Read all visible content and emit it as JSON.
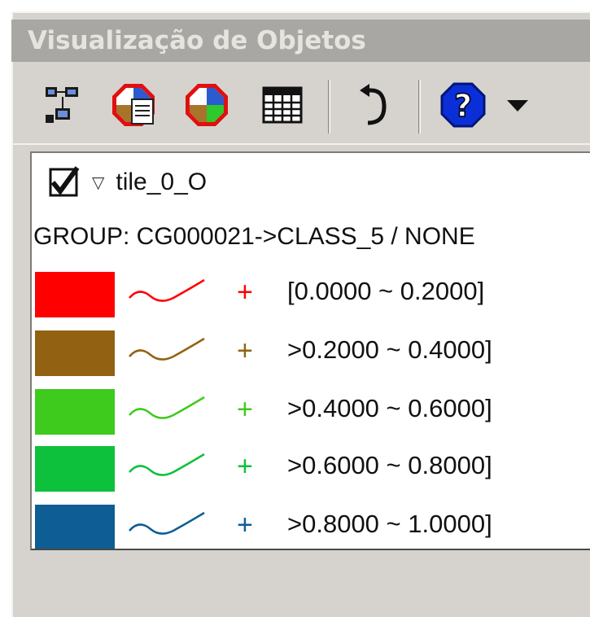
{
  "window": {
    "title": "Visualização de Objetos"
  },
  "toolbar": {
    "buttons": [
      {
        "name": "tree-layout-icon"
      },
      {
        "name": "layer-properties-icon"
      },
      {
        "name": "layer-style-icon"
      },
      {
        "name": "table-icon"
      },
      {
        "name": "undo-icon"
      },
      {
        "name": "help-icon"
      },
      {
        "name": "dropdown-arrow-icon"
      }
    ]
  },
  "tree": {
    "node": {
      "label": "tile_0_O",
      "checked": true,
      "expander": "▽"
    },
    "group_label": "GROUP: CG000021->CLASS_5 / NONE",
    "legend": [
      {
        "color": "#ff0000",
        "marker": "+",
        "range": "[0.0000 ~ 0.2000]"
      },
      {
        "color": "#926111",
        "marker": "+",
        "range": ">0.2000 ~ 0.4000]"
      },
      {
        "color": "#3fca1e",
        "marker": "+",
        "range": ">0.4000 ~ 0.6000]"
      },
      {
        "color": "#0ec13c",
        "marker": "+",
        "range": ">0.6000 ~ 0.8000]"
      },
      {
        "color": "#0e5d94",
        "marker": "+",
        "range": ">0.8000 ~ 1.0000]"
      }
    ]
  }
}
